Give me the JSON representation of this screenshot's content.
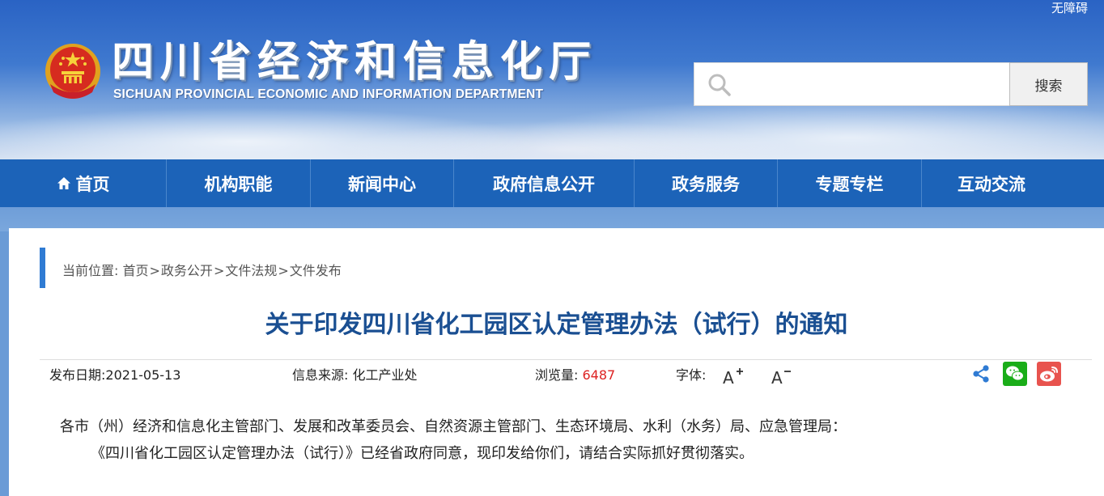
{
  "header": {
    "accessibility_label": "无障碍",
    "site_title": "四川省经济和信息化厅",
    "site_subtitle": "SICHUAN PROVINCIAL ECONOMIC AND INFORMATION DEPARTMENT",
    "search": {
      "placeholder": "",
      "button_label": "搜索"
    }
  },
  "nav": {
    "items": [
      {
        "label": "首页",
        "icon": "home-icon"
      },
      {
        "label": "机构职能"
      },
      {
        "label": "新闻中心"
      },
      {
        "label": "政府信息公开"
      },
      {
        "label": "政务服务"
      },
      {
        "label": "专题专栏"
      },
      {
        "label": "互动交流"
      }
    ]
  },
  "breadcrumb": {
    "prefix": "当前位置:",
    "items": [
      "首页",
      "政务公开",
      "文件法规",
      "文件发布"
    ],
    "separator": ">"
  },
  "article": {
    "title": "关于印发四川省化工园区认定管理办法（试行）的通知",
    "meta": {
      "date_label": "发布日期:",
      "date_value": "2021-05-13",
      "source_label": "信息来源:",
      "source_value": "化工产业处",
      "views_label": "浏览量:",
      "views_value": "6487",
      "font_label": "字体:"
    },
    "share_icons": [
      "share-icon",
      "wechat-icon",
      "weibo-icon"
    ],
    "paragraphs": [
      "各市（州）经济和信息化主管部门、发展和改革委员会、自然资源主管部门、生态环境局、水利（水务）局、应急管理局：",
      "《四川省化工园区认定管理办法（试行）》已经省政府同意，现印发给你们，请结合实际抓好贯彻落实。"
    ]
  },
  "colors": {
    "nav_bg": "#1c63b8",
    "title_color": "#1a4f92",
    "views_color": "#dd2222",
    "wechat_green": "#1aad19",
    "weibo_red": "#e8534e",
    "crumb_accent": "#2f7bd3"
  }
}
